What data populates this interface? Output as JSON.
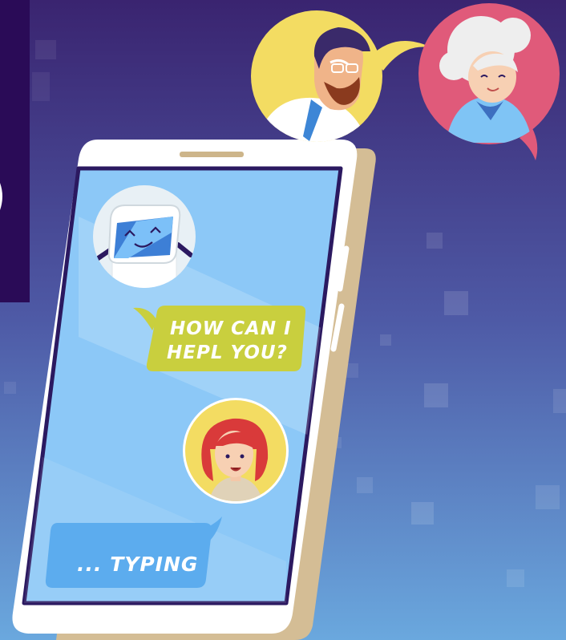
{
  "chat": {
    "bot_message_line1": "HOW CAN I",
    "bot_message_line2": "HEPL YOU?",
    "typing_text": "... TYPING"
  },
  "colors": {
    "bg_top": "#3a2470",
    "bg_bottom": "#6aa4dc",
    "screen": "#8cc8f7",
    "bot_bubble": "#c9cf3e",
    "typing_bubble": "#5cacee",
    "phone_body": "#ffffff",
    "phone_shadow": "#d4bd95"
  },
  "icons": [
    "robot-avatar-icon",
    "man-avatar-icon",
    "grandma-avatar-icon",
    "woman-avatar-icon"
  ]
}
